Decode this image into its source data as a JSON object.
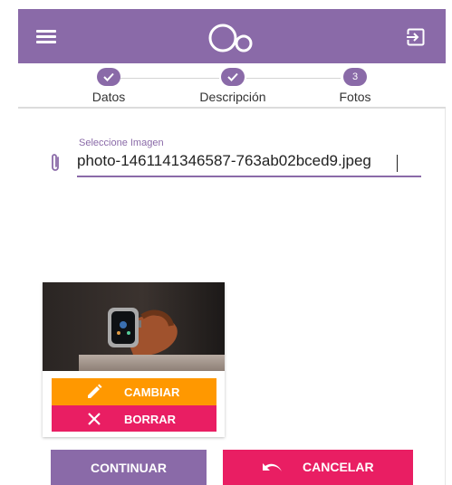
{
  "colors": {
    "primary": "#8a6aa8",
    "accent_orange": "#ff9800",
    "accent_pink": "#e91e63"
  },
  "header": {
    "menu_icon": "hamburger-menu-icon",
    "logo_icon": "bubbles-logo-icon",
    "logout_icon": "logout-icon"
  },
  "stepper": {
    "steps": [
      {
        "label": "Datos",
        "state": "done",
        "number": ""
      },
      {
        "label": "Descripción",
        "state": "done",
        "number": ""
      },
      {
        "label": "Fotos",
        "state": "active",
        "number": "3"
      }
    ]
  },
  "image_field": {
    "label": "Seleccione Imagen",
    "value": "photo-1461141346587-763ab02bced9.jpeg",
    "icon": "paperclip-icon"
  },
  "photo_card": {
    "change_label": "CAMBIAR",
    "delete_label": "BORRAR"
  },
  "actions": {
    "continue_label": "CONTINUAR",
    "cancel_label": "CANCELAR"
  }
}
